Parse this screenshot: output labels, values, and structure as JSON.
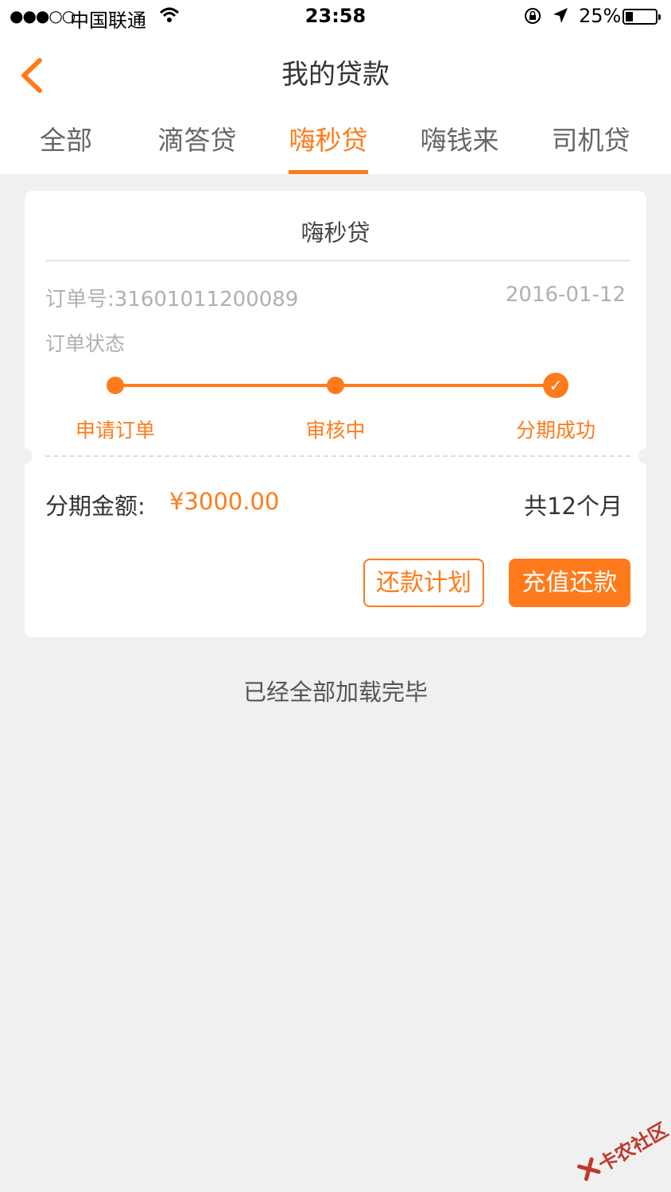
{
  "status_bar": {
    "signal": "●●●○○",
    "carrier": "中国联通",
    "time": "23:58",
    "battery_percent": "25%",
    "battery_level": 0.25
  },
  "header": {
    "title": "我的贷款"
  },
  "tabs": [
    {
      "label": "全部",
      "active": false
    },
    {
      "label": "滴答贷",
      "active": false
    },
    {
      "label": "嗨秒贷",
      "active": true
    },
    {
      "label": "嗨钱来",
      "active": false
    },
    {
      "label": "司机贷",
      "active": false
    }
  ],
  "card": {
    "title": "嗨秒贷",
    "order_no": "订单号:31601011200089",
    "date": "2016-01-12",
    "status_label": "订单状态",
    "steps": [
      "申请订单",
      "审核中",
      "分期成功"
    ],
    "amount_label": "分期金额:",
    "amount_value": "¥3000.00",
    "term": "共12个月",
    "plan_button": "还款计划",
    "pay_button": "充值还款"
  },
  "footer": {
    "loaded_text": "已经全部加载完毕"
  },
  "watermark": {
    "text": "卡农社区"
  },
  "colors": {
    "accent": "#ff7a1a",
    "background": "#f0f0f0",
    "muted": "#b0b0b0"
  }
}
